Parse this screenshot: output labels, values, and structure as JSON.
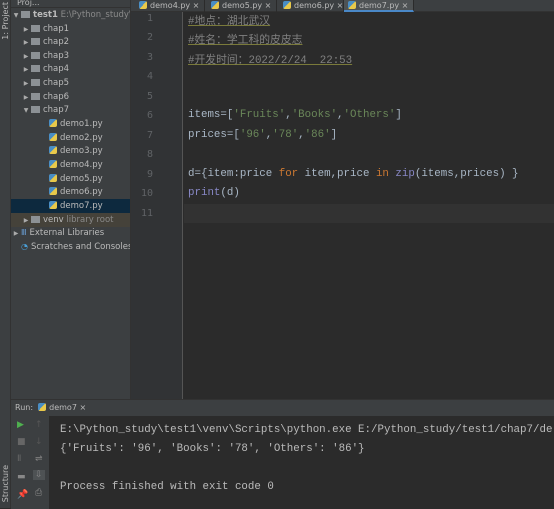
{
  "side_strip": {
    "project_label": "1: Project",
    "structure_label": "Structure"
  },
  "project": {
    "header": "Proj...",
    "root": {
      "name": "test1",
      "path": "E:\\Python_study\\te"
    },
    "folders": [
      "chap1",
      "chap2",
      "chap3",
      "chap4",
      "chap5",
      "chap6",
      "chap7"
    ],
    "files": [
      "demo1.py",
      "demo2.py",
      "demo3.py",
      "demo4.py",
      "demo5.py",
      "demo6.py",
      "demo7.py"
    ],
    "selected": "demo7.py",
    "venv": {
      "name": "venv",
      "note": "library root"
    },
    "external": "External Libraries",
    "scratches": "Scratches and Consoles"
  },
  "tabs": [
    "demo4.py",
    "demo5.py",
    "demo6.py",
    "demo7.py"
  ],
  "active_tab": "demo7.py",
  "editor": {
    "line_numbers": [
      "1",
      "2",
      "3",
      "4",
      "5",
      "6",
      "7",
      "8",
      "9",
      "10",
      "11"
    ],
    "comments": [
      "#地点：湖北武汉",
      "#姓名：学工科的皮皮志",
      "#开发时间：2022/2/24  22:53"
    ],
    "line6": {
      "a": "items=[",
      "s1": "'Fruits'",
      "c1": ",",
      "s2": "'Books'",
      "c2": ",",
      "s3": "'Others'",
      "e": "]"
    },
    "line7": {
      "a": "prices=[",
      "s1": "'96'",
      "c1": ",",
      "s2": "'78'",
      "c2": ",",
      "s3": "'86'",
      "e": "]"
    },
    "line9": {
      "a": "d={item:price ",
      "k1": "for",
      "b": " item,price ",
      "k2": "in",
      "c": " ",
      "f": "zip",
      "d": "(items,prices) }"
    },
    "line10": {
      "f": "print",
      "a": "(d)"
    }
  },
  "run": {
    "label": "Run:",
    "tab": "demo7",
    "output": [
      "E:\\Python_study\\test1\\venv\\Scripts\\python.exe E:/Python_study/test1/chap7/de",
      "{'Fruits': '96', 'Books': '78', 'Others': '86'}",
      "",
      "Process finished with exit code 0"
    ]
  }
}
